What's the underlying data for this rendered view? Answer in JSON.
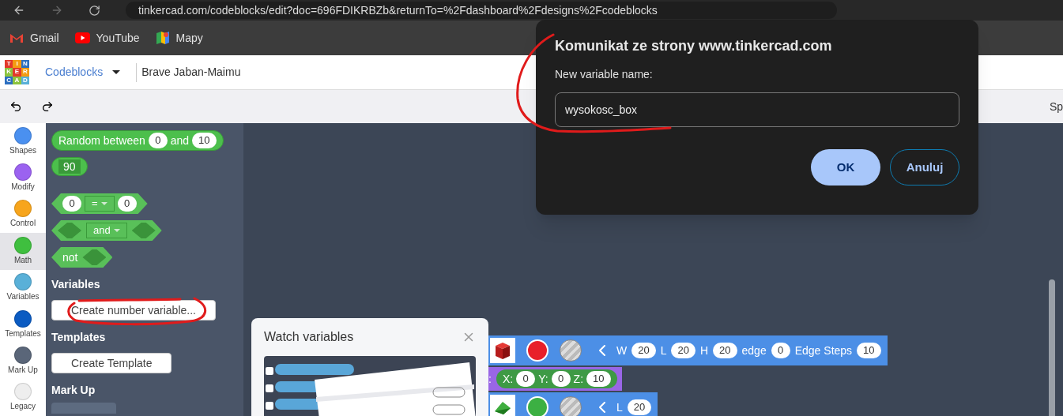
{
  "browser": {
    "url": "tinkercad.com/codeblocks/edit?doc=696FDIKRBZb&returnTo=%2Fdashboard%2Fdesigns%2Fcodeblocks",
    "bookmarks": [
      {
        "label": "Gmail",
        "kind": "gmail"
      },
      {
        "label": "YouTube",
        "kind": "youtube"
      },
      {
        "label": "Mapy",
        "kind": "maps"
      }
    ]
  },
  "header": {
    "logo": [
      "T",
      "I",
      "N",
      "K",
      "E",
      "R",
      "C",
      "A",
      "D"
    ],
    "mode": "Codeblocks",
    "design_name": "Brave Jaban-Maimu"
  },
  "toolbar": {
    "right_text": "Sp"
  },
  "categories": [
    {
      "label": "Shapes",
      "color": "#4a90f0",
      "selected": false
    },
    {
      "label": "Modify",
      "color": "#9b62f0",
      "selected": false
    },
    {
      "label": "Control",
      "color": "#f7a51c",
      "selected": false
    },
    {
      "label": "Math",
      "color": "#3fbf3f",
      "selected": true
    },
    {
      "label": "Variables",
      "color": "#59b0d8",
      "selected": false
    },
    {
      "label": "Templates",
      "color": "#0b5bc2",
      "selected": false
    },
    {
      "label": "Mark Up",
      "color": "#5a6679",
      "selected": false
    },
    {
      "label": "Legacy",
      "color": "#eeeeee",
      "selected": false
    }
  ],
  "flyout": [
    {
      "kind": "random",
      "label": "Random between",
      "a": "0",
      "joiner": "and",
      "b": "10"
    },
    {
      "kind": "number",
      "value": "90"
    },
    {
      "kind": "compare",
      "a": "0",
      "op": "=",
      "b": "0"
    },
    {
      "kind": "logic",
      "op": "and"
    },
    {
      "kind": "not",
      "label": "not"
    },
    {
      "kind": "heading",
      "label": "Variables"
    },
    {
      "kind": "button",
      "label": "Create number variable..."
    },
    {
      "kind": "heading",
      "label": "Templates"
    },
    {
      "kind": "button",
      "label": "Create Template"
    },
    {
      "kind": "heading",
      "label": "Mark Up"
    },
    {
      "kind": "stub"
    }
  ],
  "canvas_blocks": [
    {
      "kind": "box",
      "color": "#e8202a",
      "params": [
        {
          "label": "W",
          "value": "20"
        },
        {
          "label": "L",
          "value": "20"
        },
        {
          "label": "H",
          "value": "20"
        },
        {
          "label": "edge",
          "value": "0"
        },
        {
          "label": "Edge Steps",
          "value": "10"
        }
      ]
    },
    {
      "kind": "position",
      "lead": ":",
      "params": [
        {
          "label": "X:",
          "value": "0"
        },
        {
          "label": "Y:",
          "value": "0"
        },
        {
          "label": "Z:",
          "value": "10"
        }
      ]
    },
    {
      "kind": "wedge",
      "color": "#3cb043",
      "params": [
        {
          "label": "L",
          "value": "20"
        }
      ]
    }
  ],
  "watch_panel": {
    "title": "Watch variables"
  },
  "dialog": {
    "title": "Komunikat ze strony www.tinkercad.com",
    "label": "New variable name:",
    "value": "wysokosc_box",
    "buttons": [
      {
        "label": "OK",
        "primary": true
      },
      {
        "label": "Anuluj",
        "primary": false
      }
    ]
  }
}
